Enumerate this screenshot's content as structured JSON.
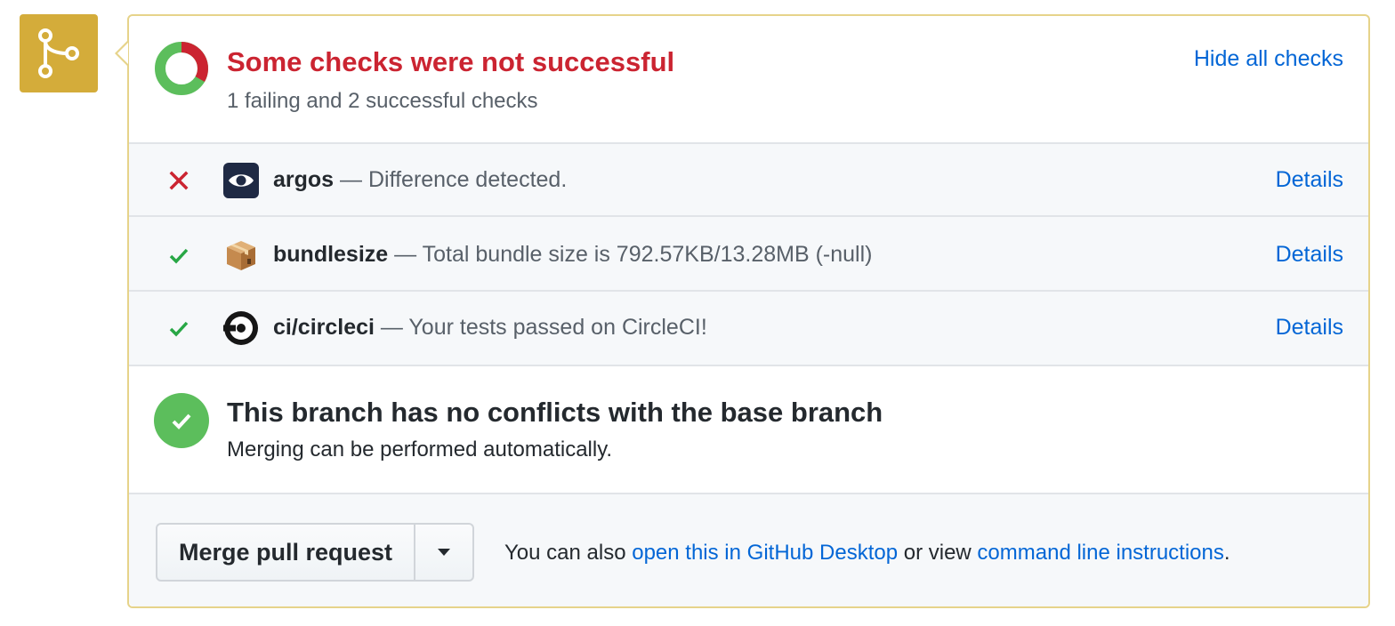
{
  "status": {
    "title": "Some checks were not successful",
    "summary": "1 failing and 2 successful checks",
    "toggle_label": "Hide all checks",
    "failing_count": 1,
    "successful_count": 2
  },
  "checks": [
    {
      "state": "failure",
      "icon": "argos-eye-icon",
      "name": "argos",
      "description": " — Difference detected.",
      "details_label": "Details"
    },
    {
      "state": "success",
      "icon": "package-box-icon",
      "name": "bundlesize",
      "description": " — Total bundle size is 792.57KB/13.28MB (-null)",
      "details_label": "Details"
    },
    {
      "state": "success",
      "icon": "circleci-logo-icon",
      "name": "ci/circleci",
      "description": " — Your tests passed on CircleCI!",
      "details_label": "Details"
    }
  ],
  "merge": {
    "title": "This branch has no conflicts with the base branch",
    "subtitle": "Merging can be performed automatically.",
    "button_label": "Merge pull request",
    "alt_prefix": "You can also ",
    "desktop_link": "open this in GitHub Desktop",
    "alt_middle": " or view ",
    "cli_link": "command line instructions",
    "alt_suffix": "."
  },
  "colors": {
    "failure": "#cb2431",
    "success": "#28a745",
    "link": "#0366d6",
    "badge": "#d4ac3a"
  }
}
